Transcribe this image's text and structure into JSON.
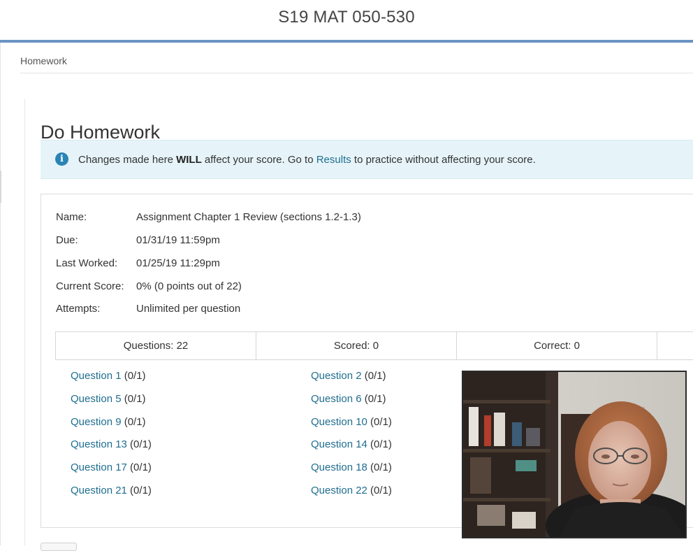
{
  "header": {
    "course_title": "S19 MAT 050-530"
  },
  "breadcrumb": {
    "label": "Homework"
  },
  "page": {
    "title": "Do Homework"
  },
  "alert": {
    "icon": "info-icon",
    "text_before": "Changes made here ",
    "emphasis": "WILL",
    "text_middle": " affect your score. Go to ",
    "link": "Results",
    "text_after": " to practice without affecting your score."
  },
  "assignment": {
    "rows": [
      {
        "label": "Name:",
        "value": "Assignment Chapter 1 Review (sections 1.2-1.3)"
      },
      {
        "label": "Due:",
        "value": "01/31/19 11:59pm"
      },
      {
        "label": "Last Worked:",
        "value": "01/25/19 11:29pm"
      },
      {
        "label": "Current Score:",
        "value": "0% (0 points out of 22)"
      },
      {
        "label": "Attempts:",
        "value": "Unlimited per question"
      }
    ]
  },
  "stats": [
    "Questions: 22",
    "Scored: 0",
    "Correct: 0",
    ""
  ],
  "questions": [
    {
      "link": "Question 1",
      "score": " (0/1)"
    },
    {
      "link": "Question 2",
      "score": " (0/1)"
    },
    {
      "link": "Question 5",
      "score": " (0/1)"
    },
    {
      "link": "Question 6",
      "score": " (0/1)"
    },
    {
      "link": "Question 9",
      "score": " (0/1)"
    },
    {
      "link": "Question 10",
      "score": " (0/1)"
    },
    {
      "link": "Question 13",
      "score": " (0/1)"
    },
    {
      "link": "Question 14",
      "score": " (0/1)"
    },
    {
      "link": "Question 17",
      "score": " (0/1)"
    },
    {
      "link": "Question 18",
      "score": " (0/1)"
    },
    {
      "link": "Question 21",
      "score": " (0/1)"
    },
    {
      "link": "Question 22",
      "score": " (0/1)"
    }
  ],
  "colors": {
    "accent_bar": "#6b93c4",
    "link": "#1f6e8f",
    "alert_bg": "#e6f4f9",
    "info_icon": "#2a84b6"
  }
}
